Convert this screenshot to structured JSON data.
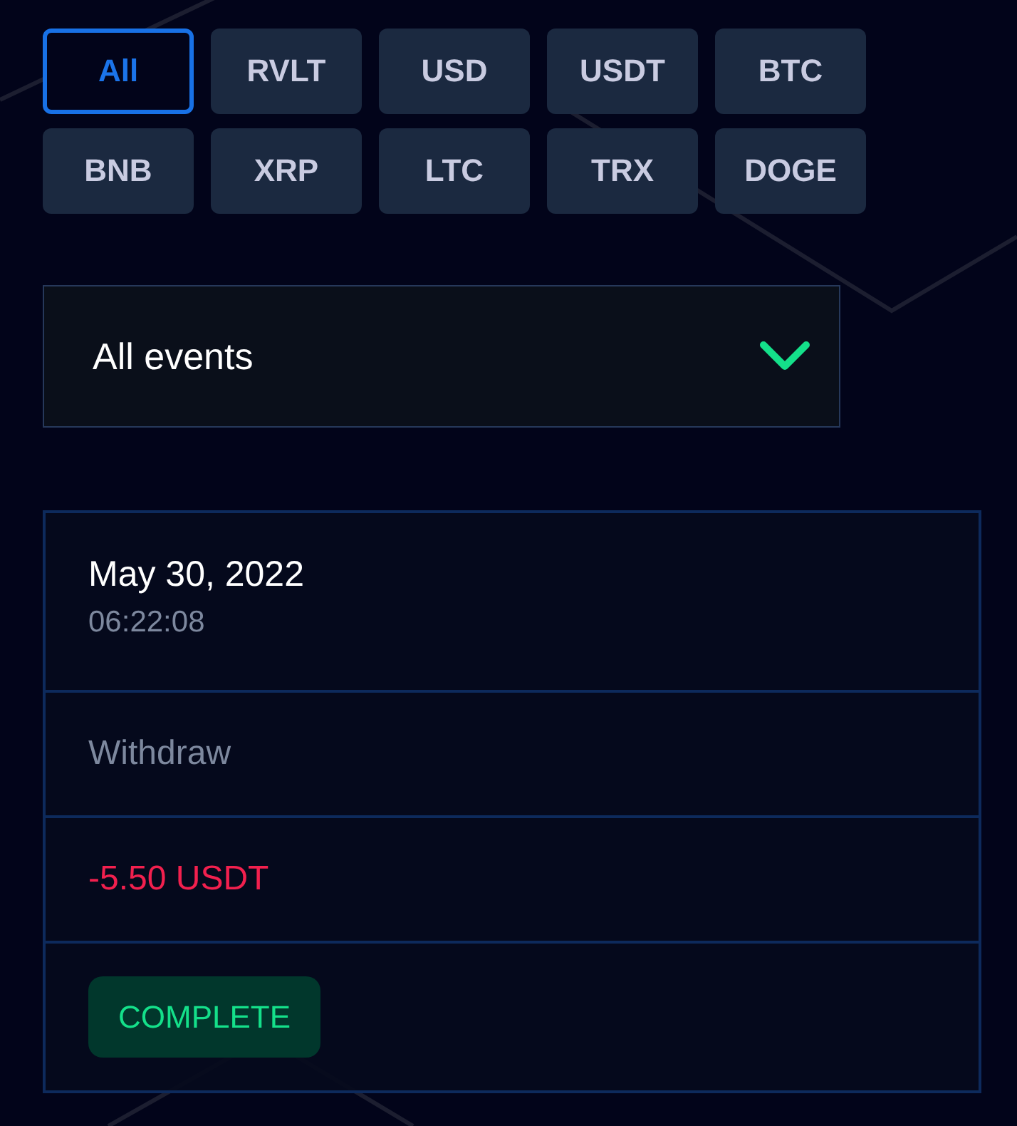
{
  "currency_filters": [
    {
      "label": "All",
      "selected": true
    },
    {
      "label": "RVLT",
      "selected": false
    },
    {
      "label": "USD",
      "selected": false
    },
    {
      "label": "USDT",
      "selected": false
    },
    {
      "label": "BTC",
      "selected": false
    },
    {
      "label": "BNB",
      "selected": false
    },
    {
      "label": "XRP",
      "selected": false
    },
    {
      "label": "LTC",
      "selected": false
    },
    {
      "label": "TRX",
      "selected": false
    },
    {
      "label": "DOGE",
      "selected": false
    }
  ],
  "event_filter": {
    "value": "All events"
  },
  "transaction": {
    "date": "May 30, 2022",
    "time": "06:22:08",
    "type": "Withdraw",
    "amount": "-5.50 USDT",
    "status": "COMPLETE"
  }
}
